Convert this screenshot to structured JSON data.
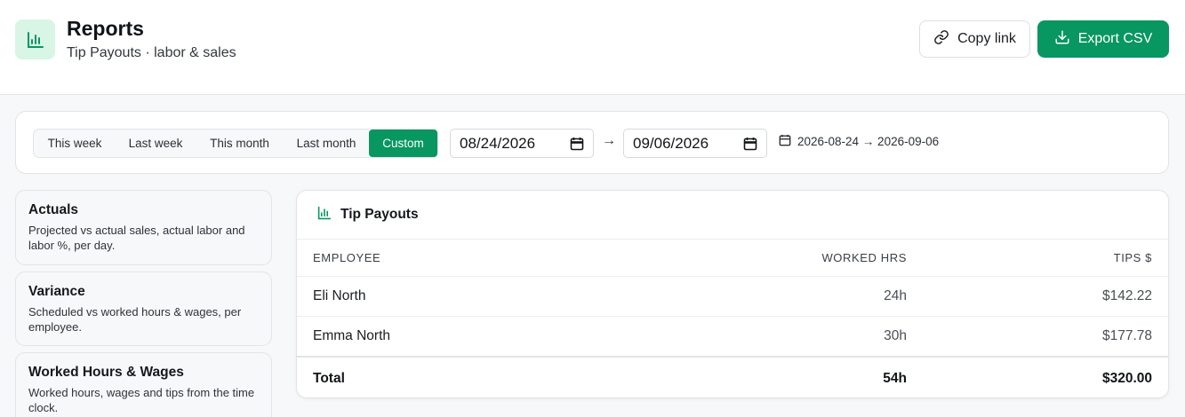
{
  "header": {
    "title": "Reports",
    "subtitle": "Tip Payouts · labor & sales",
    "copy_link_label": "Copy link",
    "export_label": "Export CSV",
    "accent_color": "#089661",
    "icon_bg": "#d8f5e6"
  },
  "filters": {
    "presets": [
      "This week",
      "Last week",
      "This month",
      "Last month",
      "Custom"
    ],
    "active_preset": "Custom",
    "start_date": "08/24/2026",
    "end_date": "09/06/2026",
    "arrow": "→",
    "range_label": "2026-08-24 → 2026-09-06"
  },
  "sidebar": {
    "reports": [
      {
        "title": "Actuals",
        "description": "Projected vs actual sales, actual labor and labor %, per day."
      },
      {
        "title": "Variance",
        "description": "Scheduled vs worked hours & wages, per employee."
      },
      {
        "title": "Worked Hours & Wages",
        "description": "Worked hours, wages and tips from the time clock."
      }
    ]
  },
  "table": {
    "title": "Tip Payouts",
    "columns": [
      "EMPLOYEE",
      "WORKED HRS",
      "TIPS $"
    ],
    "rows": [
      {
        "employee": "Eli North",
        "worked_hrs": "24h",
        "tips": "$142.22"
      },
      {
        "employee": "Emma North",
        "worked_hrs": "30h",
        "tips": "$177.78"
      }
    ],
    "total": {
      "label": "Total",
      "worked_hrs": "54h",
      "tips": "$320.00"
    }
  }
}
